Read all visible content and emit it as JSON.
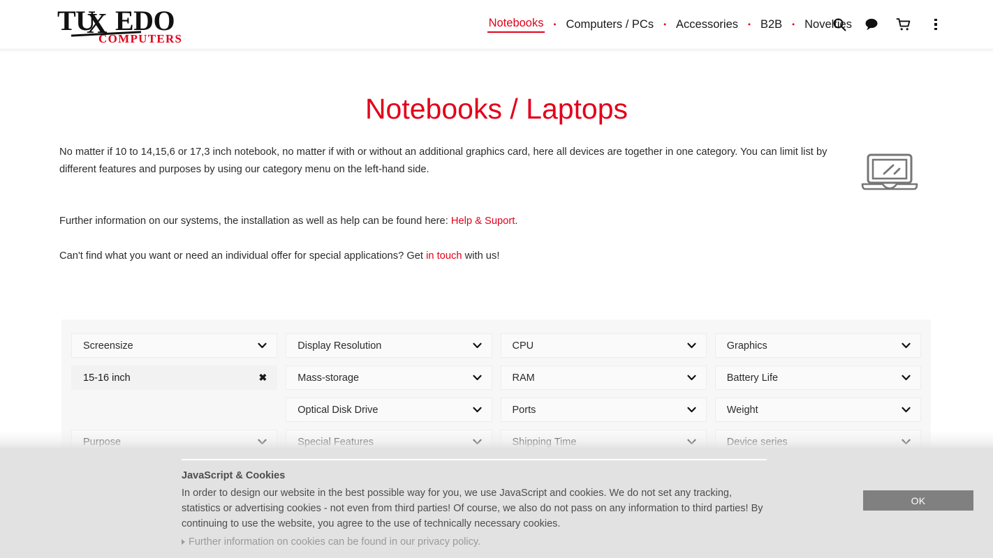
{
  "brand": {
    "logo_main": "TU",
    "logo_x": "X",
    "logo_end": "EDO",
    "logo_sub": "COMPUTERS",
    "accent_color": "#e2001a"
  },
  "nav": {
    "items": [
      {
        "label": "Notebooks",
        "active": true
      },
      {
        "label": "Computers / PCs",
        "active": false
      },
      {
        "label": "Accessories",
        "active": false
      },
      {
        "label": "B2B",
        "active": false
      },
      {
        "label": "Novelties",
        "active": false
      }
    ],
    "separator": "⬩",
    "icons": [
      {
        "name": "search-icon",
        "title": "Search"
      },
      {
        "name": "chat-icon",
        "title": "Chat"
      },
      {
        "name": "cart-icon",
        "title": "Shopping cart"
      },
      {
        "name": "more-menu-icon",
        "title": "More"
      }
    ]
  },
  "page": {
    "title": "Notebooks / Laptops",
    "intro": {
      "paragraph1": "No matter if 10 to 14,15,6 or 17,3 inch notebook, no matter if with or without an additional graphics card, here all devices are together in one category. You can limit list by different features and purposes by using our category menu on the left-hand side.",
      "paragraph2_before": "Further information on our systems, the installation as well as help can be found here: ",
      "paragraph2_link": "Help & Suport",
      "paragraph2_after": ".",
      "paragraph3_before": "Can't find what you want or need an individual offer for special applications? Get ",
      "paragraph3_link": "in touch",
      "paragraph3_after": " with us!"
    },
    "hero_icon": "laptop-icon"
  },
  "filters": {
    "columns": [
      {
        "boxes": [
          {
            "label": "Screensize",
            "type": "dropdown"
          },
          {
            "label": "15-16 inch",
            "type": "chip",
            "remove": "✖"
          },
          {
            "label": "",
            "type": "spacer"
          },
          {
            "label": "Purpose",
            "type": "dropdown"
          }
        ]
      },
      {
        "boxes": [
          {
            "label": "Display Resolution",
            "type": "dropdown"
          },
          {
            "label": "Mass-storage",
            "type": "dropdown"
          },
          {
            "label": "Optical Disk Drive",
            "type": "dropdown"
          },
          {
            "label": "Special Features",
            "type": "dropdown"
          }
        ]
      },
      {
        "boxes": [
          {
            "label": "CPU",
            "type": "dropdown"
          },
          {
            "label": "RAM",
            "type": "dropdown"
          },
          {
            "label": "Ports",
            "type": "dropdown"
          },
          {
            "label": "Shipping Time",
            "type": "dropdown"
          }
        ]
      },
      {
        "boxes": [
          {
            "label": "Graphics",
            "type": "dropdown"
          },
          {
            "label": "Battery Life",
            "type": "dropdown"
          },
          {
            "label": "Weight",
            "type": "dropdown"
          },
          {
            "label": "Device series",
            "type": "dropdown"
          }
        ]
      }
    ]
  },
  "cookie_banner": {
    "title": "JavaScript & Cookies",
    "text": "In order to design our website in the best possible way for you, we use JavaScript and cookies. We do not set any tracking, statistics or advertising cookies - not even from third parties! Of course, we also do not pass on any information to third parties! By continuing to use the website, you agree to the use of technically necessary cookies.",
    "link": "Further information on cookies can be found in our privacy policy.",
    "ok_label": "OK",
    "ok_color": "#808080"
  }
}
